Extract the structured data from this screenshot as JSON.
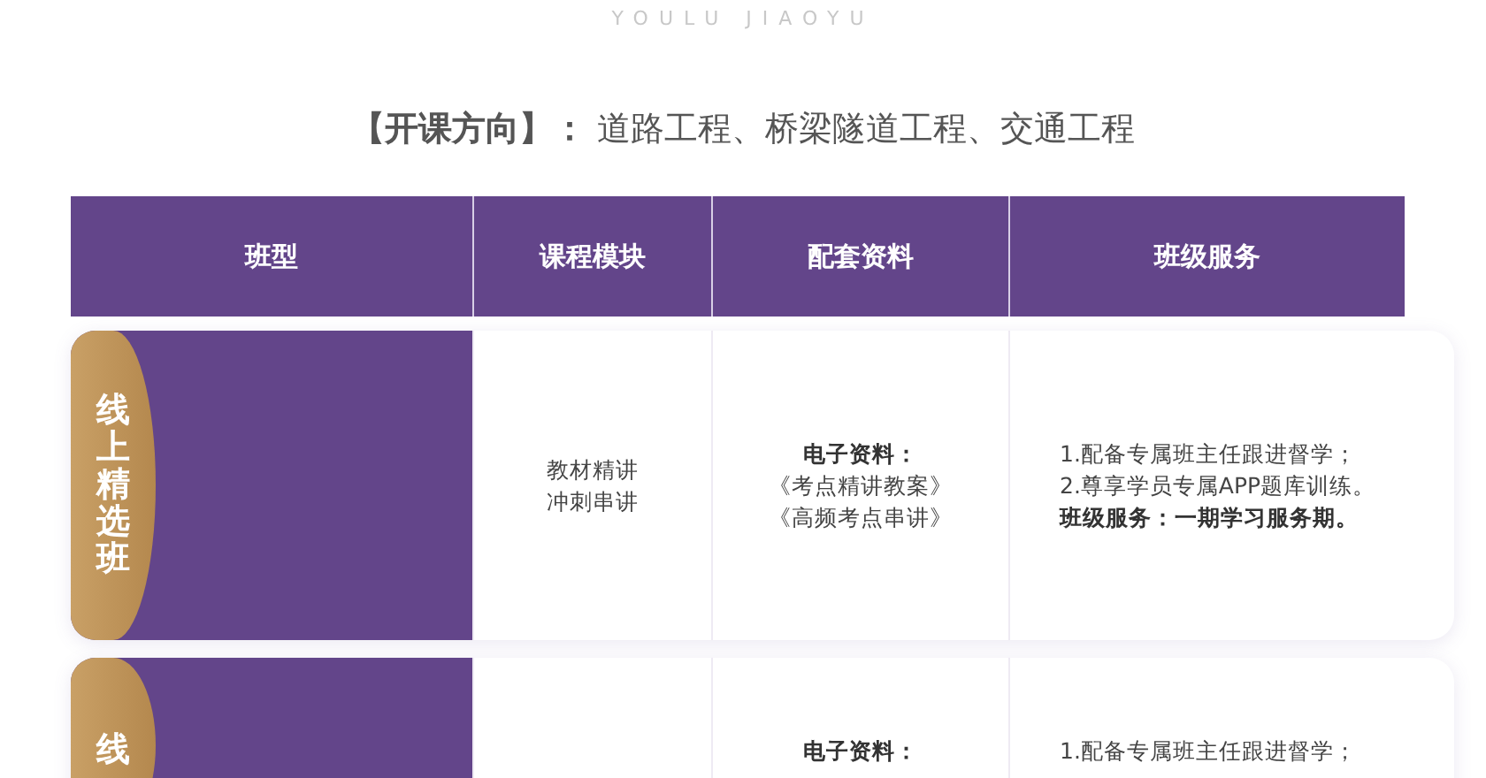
{
  "brand_tagline": "YOULU JIAOYU",
  "heading": "**【开课方向】：** 道路工程、桥梁隧道工程、交通工程",
  "table": {
    "columns": [
      "班型",
      "课程模块",
      "配套资料",
      "班级服务"
    ],
    "rows": [
      {
        "class_name": "线上精选班",
        "modules": [
          "教材精讲",
          "冲刺串讲"
        ],
        "materials": {
          "title": "电子资料：",
          "items": [
            "《考点精讲教案》",
            "《高频考点串讲》"
          ]
        },
        "services": {
          "items": [
            "1.配备专属班主任跟进督学；",
            "2.尊享学员专属APP题库训练。"
          ],
          "summary": "班级服务：一期学习服务期。"
        }
      },
      {
        "class_name": "线",
        "materials": {
          "title": "电子资料："
        },
        "services": {
          "items": [
            "1.配备专属班主任跟进督学；"
          ]
        }
      }
    ]
  }
}
